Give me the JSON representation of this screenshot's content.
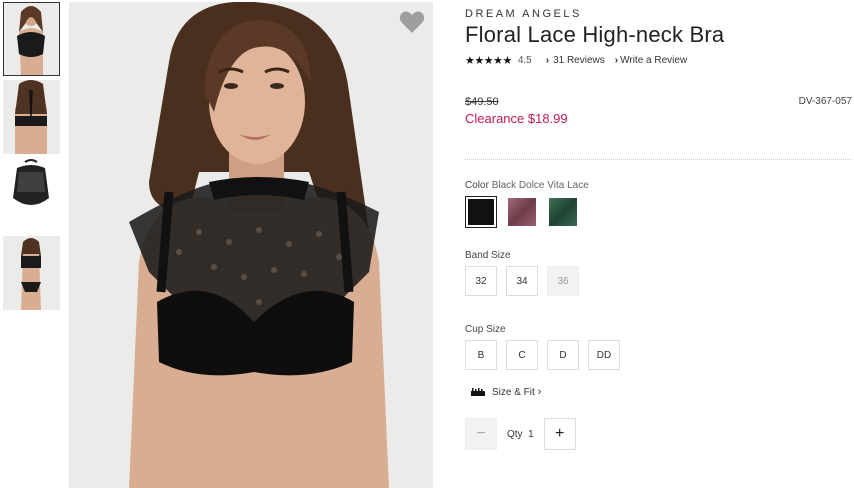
{
  "product": {
    "brand": "DREAM ANGELS",
    "title": "Floral Lace High-neck Bra",
    "stars": "★★★★★",
    "rating": "4.5",
    "reviews_label": "31 Reviews",
    "write_review_label": "Write a Review",
    "original_price": "$49.50",
    "sale_price": "Clearance $18.99",
    "sku": "DV-367-057"
  },
  "color": {
    "label": "Color",
    "selected": "Black Dolce Vita Lace",
    "swatches": [
      {
        "color": "#111111",
        "selected": true
      },
      {
        "color": "#8c5564",
        "selected": false
      },
      {
        "color": "#2f5b45",
        "selected": false
      }
    ]
  },
  "band": {
    "label": "Band Size",
    "options": [
      "32",
      "34",
      "36"
    ]
  },
  "cup": {
    "label": "Cup Size",
    "options": [
      "B",
      "C",
      "D",
      "DD"
    ]
  },
  "size_fit_label": "Size & Fit",
  "quantity": {
    "label": "Qty",
    "value": "1",
    "minus": "−",
    "plus": "+"
  },
  "icons": {
    "favorite": "heart-icon",
    "size_fit": "ruler-icon"
  },
  "colors": {
    "sale": "#c2185b",
    "image_bg": "#ebecea"
  }
}
